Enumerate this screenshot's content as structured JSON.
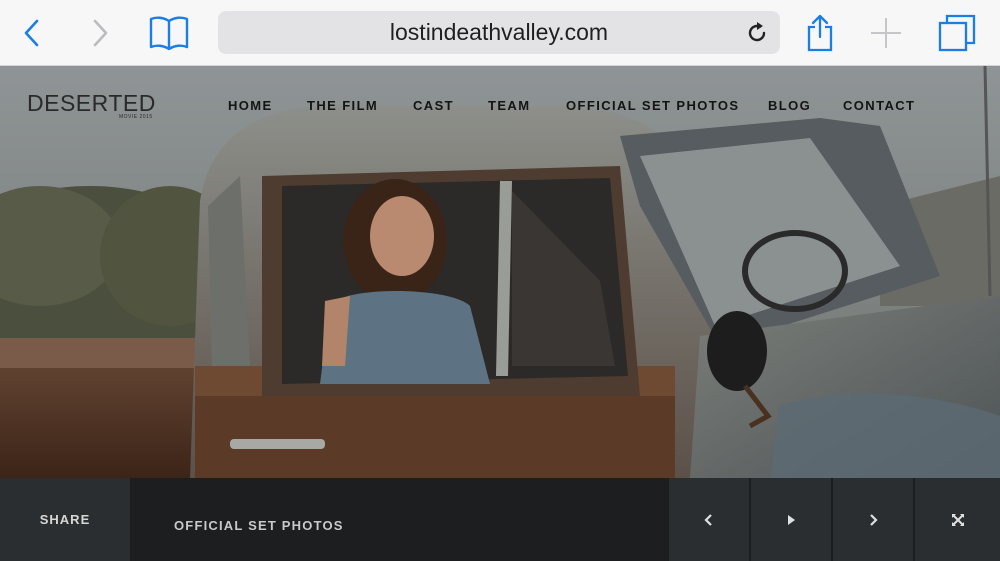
{
  "browser": {
    "url": "lostindeathvalley.com",
    "icons": [
      "back-icon",
      "forward-icon",
      "bookmarks-icon",
      "reload-icon",
      "share-icon",
      "add-tab-icon",
      "tabs-icon"
    ],
    "accent": "#1a7ee6"
  },
  "site": {
    "logo": "DESERTED",
    "logo_sub": "MOVIE 2015",
    "nav": [
      "HOME",
      "THE FILM",
      "CAST",
      "TEAM",
      "OFFICIAL SET PHOTOS",
      "BLOG",
      "CONTACT"
    ]
  },
  "gallery": {
    "share_label": "SHARE",
    "title": "OFFICIAL SET PHOTOS",
    "controls": [
      "prev-icon",
      "play-icon",
      "next-icon",
      "fullscreen-icon"
    ]
  }
}
